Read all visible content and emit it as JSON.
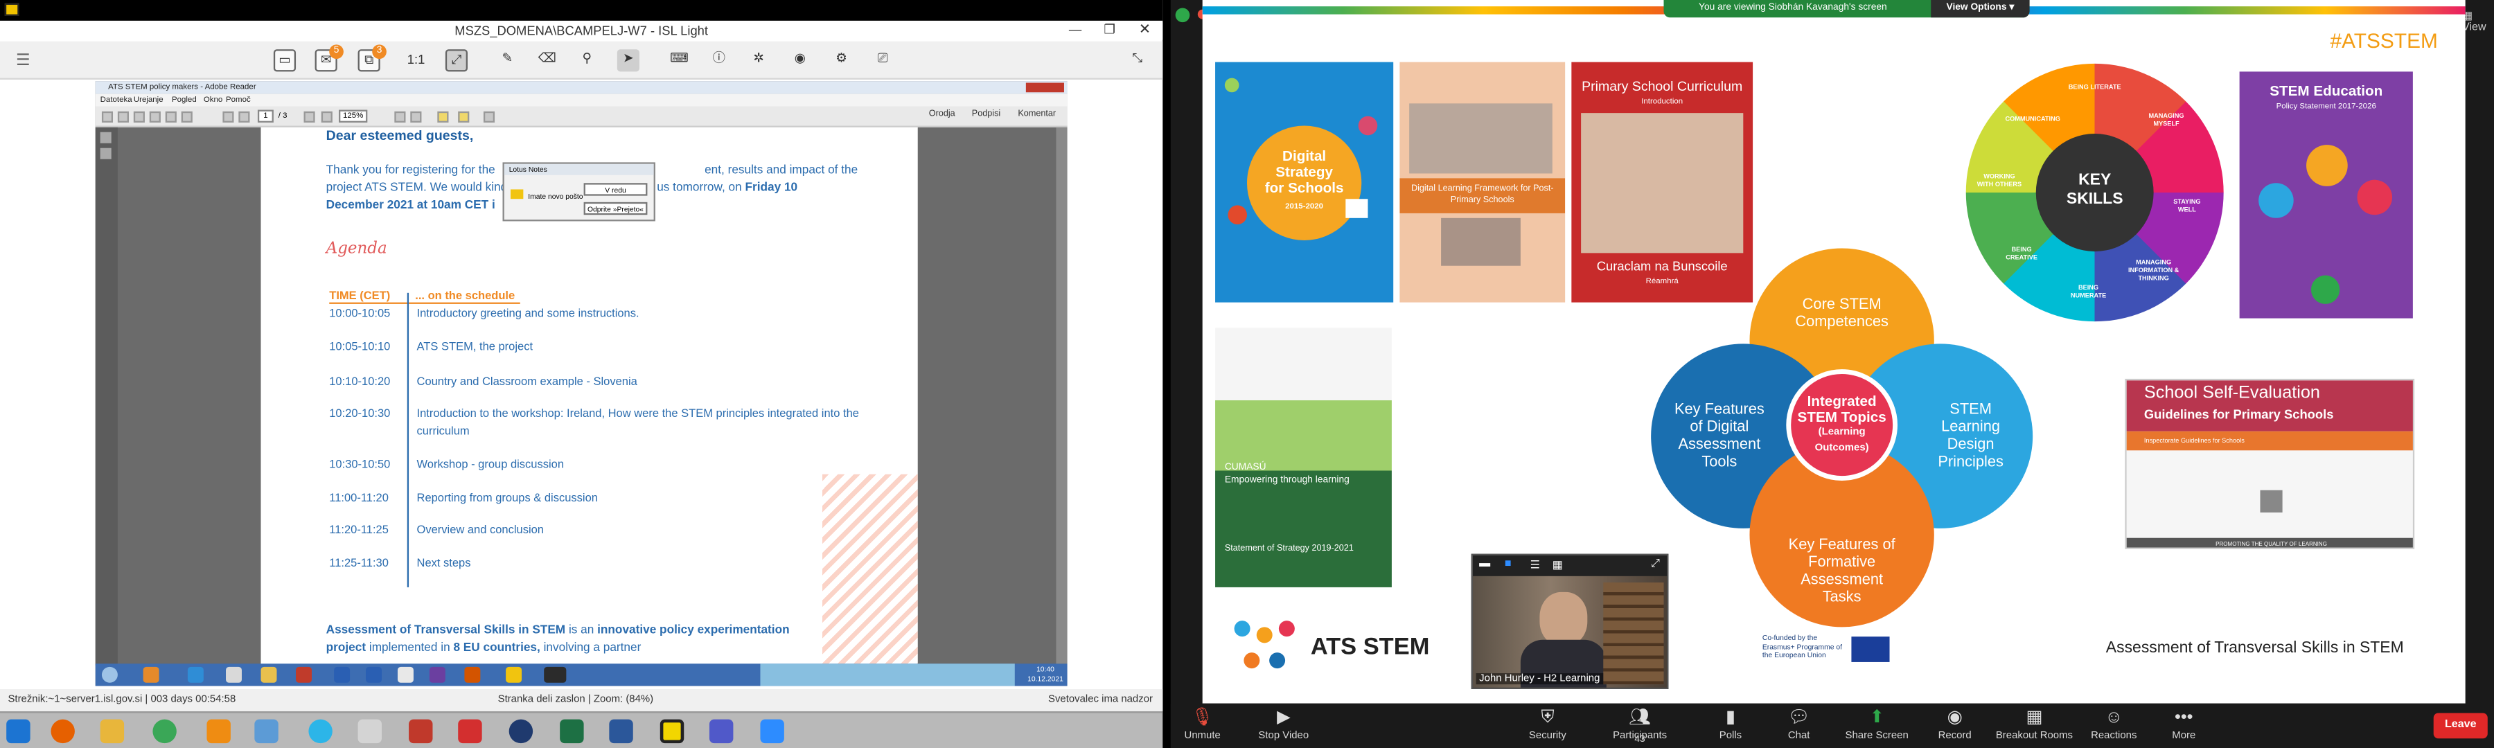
{
  "isl": {
    "window_title": "MSZS_DOMENA\\BCAMPELJ-W7 - ISL Light",
    "toolbar": {
      "zoom_label": "1:1",
      "badge_a": "5",
      "badge_b": "3"
    },
    "status_left": "Strežnik:~1~server1.isl.gov.si | 003 days 00:54:58",
    "status_mid": "Stranka deli zaslon | Zoom: (84%)",
    "status_right": "Svetovalec ima nadzor"
  },
  "reader": {
    "title": "ATS STEM policy makers - Adobe Reader",
    "menu": [
      "Datoteka",
      "Urejanje",
      "Pogled",
      "Okno",
      "Pomoč"
    ],
    "page_current": "1",
    "page_total": "/ 3",
    "zoom": "125%",
    "right_tools": [
      "Orodja",
      "Podpisi",
      "Komentar"
    ]
  },
  "doc": {
    "greeting": "Dear esteemed guests,",
    "intro_a": "Thank you for registering for the",
    "intro_b": "ent, results and impact of the",
    "intro_c": "project ATS STEM. We would kind",
    "intro_d": "us tomorrow, on",
    "intro_date_a": "Friday 10",
    "intro_date_b": "December 2021 at 10am CET i",
    "agenda_title": "Agenda",
    "sched_time_head": "TIME  (CET)",
    "sched_desc_head": "... on the schedule",
    "rows": [
      {
        "time": "10:00-10:05",
        "desc": "Introductory greeting and some instructions."
      },
      {
        "time": "10:05-10:10",
        "desc": "ATS STEM, the project"
      },
      {
        "time": "10:10-10:20",
        "desc": "Country and Classroom example - Slovenia"
      },
      {
        "time": "10:20-10:30",
        "desc": "Introduction to the workshop: Ireland, How were the STEM principles integrated into the curriculum"
      },
      {
        "time": "10:30-10:50",
        "desc": "Workshop - group discussion"
      },
      {
        "time": "11:00-11:20",
        "desc": "Reporting from groups & discussion"
      },
      {
        "time": "11:20-11:25",
        "desc": "Overview and conclusion"
      },
      {
        "time": "11:25-11:30",
        "desc": "Next steps"
      }
    ],
    "footer_bold_a": "Assessment of Transversal Skills in STEM",
    "footer_a": " is an ",
    "footer_bold_b": "innovative policy experimentation project",
    "footer_b": " implemented in ",
    "footer_bold_c": "8 EU countries,",
    "footer_c": " involving a partner"
  },
  "notes_popup": {
    "title": "Lotus Notes",
    "message": "Imate novo pošto",
    "btn1": "V redu",
    "btn2": "Odprite »Prejeto«"
  },
  "win_clock": {
    "time": "10:40",
    "date": "10.12.2021"
  },
  "zoom": {
    "banner": "You are viewing Siobhán Kavanagh's screen",
    "view_options": "View Options",
    "view_btn": "View",
    "participant_count": "43",
    "participant_name": "John Hurley - H2 Learning",
    "controls": [
      "Unmute",
      "Stop Video",
      "Security",
      "Participants",
      "Polls",
      "Chat",
      "Share Screen",
      "Record",
      "Breakout Rooms",
      "Reactions",
      "More"
    ],
    "leave": "Leave"
  },
  "slide": {
    "hashtag": "#ATSSTEM",
    "cover_digital_a": "Digital",
    "cover_digital_b": "Strategy",
    "cover_digital_c": "for Schools",
    "cover_digital_d": "2015-2020",
    "cover_dlf": "Digital Learning Framework for Post-Primary Schools",
    "cover_psc_title": "Primary School Curriculum",
    "cover_psc_sub": "Introduction",
    "cover_psc_irish": "Curaclam na Bunscoile",
    "cover_psc_irish_sub": "Réamhrá",
    "cover_cumasu_a": "CUMASÚ",
    "cover_cumasu_b": "Empowering through learning",
    "cover_cumasu_c": "Statement of Strategy 2019-2021",
    "cover_stem_title": "STEM Education",
    "cover_stem_sub": "Policy Statement 2017-2026",
    "key_skills_a": "KEY",
    "key_skills_b": "SKILLS",
    "ks_ring": [
      "BEING LITERATE",
      "MANAGING MYSELF",
      "STAYING WELL",
      "MANAGING INFORMATION & THINKING",
      "BEING NUMERATE",
      "BEING CREATIVE",
      "WORKING WITH OTHERS",
      "COMMUNICATING"
    ],
    "petal_top": "Core STEM Competences",
    "petal_left": "Key Features of Digital Assessment Tools",
    "petal_right": "STEM Learning Design Principles",
    "petal_bottom": "Key Features of Formative Assessment Tasks",
    "center_a": "Integrated STEM Topics",
    "center_b": "(Learning Outcomes)",
    "sse_title": "School Self-Evaluation",
    "sse_sub": "Guidelines for Primary Schools",
    "sse_small": "Inspectorate Guidelines for Schools",
    "sse_footer": "PROMOTING THE QUALITY OF LEARNING",
    "ats_logo": "ATS STEM",
    "erasmus": "Co-funded by the Erasmus+ Programme of the European Union",
    "bottom_right": "Assessment of Transversal Skills in STEM"
  },
  "colors": {
    "petal_orange": "#f5a01c",
    "petal_blue": "#1a6fb0",
    "petal_cyan": "#2ca6e0",
    "center_red": "#e63552",
    "zoom_green": "#23863a",
    "leave_red": "#e02828"
  }
}
